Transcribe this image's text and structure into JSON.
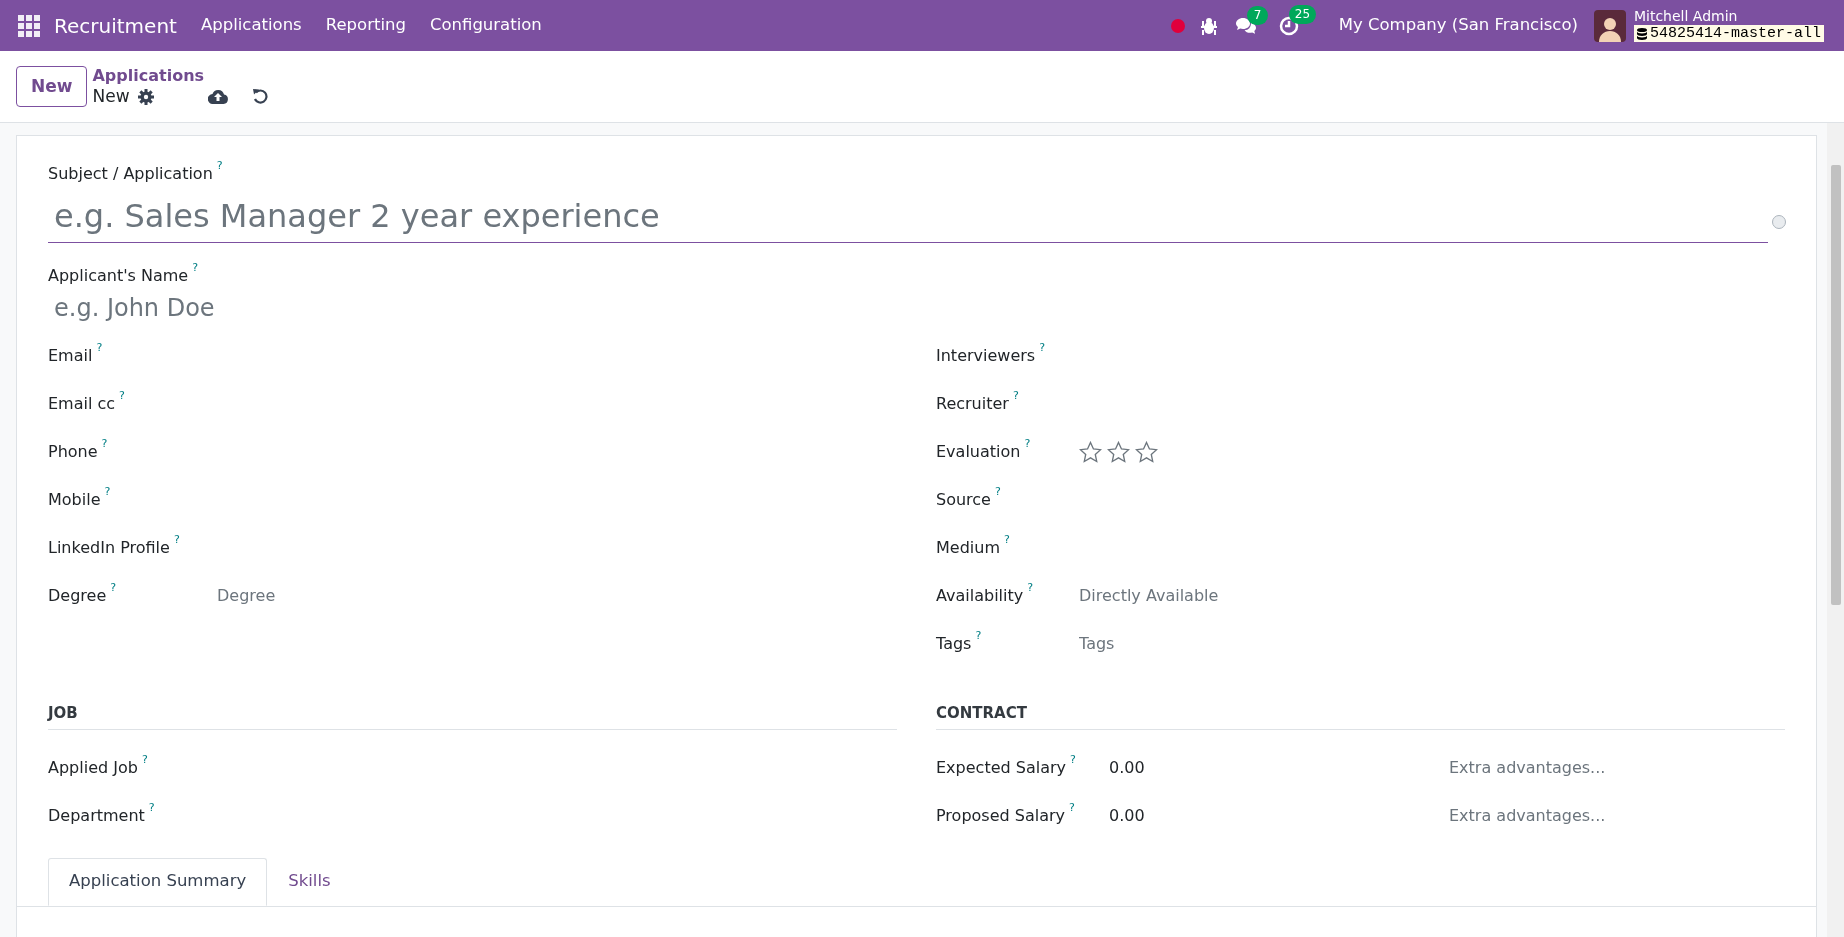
{
  "navbar": {
    "app_name": "Recruitment",
    "menus": [
      "Applications",
      "Reporting",
      "Configuration"
    ],
    "chat_count": "7",
    "activity_count": "25",
    "company": "My Company (San Francisco)",
    "user_name": "Mitchell Admin",
    "database": "54825414-master-all"
  },
  "control_panel": {
    "new_button": "New",
    "breadcrumb": "Applications",
    "record": "New"
  },
  "form": {
    "subject": {
      "label": "Subject / Application",
      "help": "?",
      "placeholder": "e.g. Sales Manager 2 year experience"
    },
    "applicant_name": {
      "label": "Applicant's Name",
      "help": "?",
      "placeholder": "e.g. John Doe"
    },
    "left_fields": [
      {
        "kind": "text",
        "label": "Email",
        "help": "?"
      },
      {
        "kind": "text",
        "label": "Email cc",
        "help": "?"
      },
      {
        "kind": "text",
        "label": "Phone",
        "help": "?"
      },
      {
        "kind": "text",
        "label": "Mobile",
        "help": "?"
      },
      {
        "kind": "text",
        "label": "LinkedIn Profile",
        "help": "?"
      },
      {
        "kind": "text",
        "label": "Degree",
        "help": "?",
        "placeholder": "Degree"
      }
    ],
    "right_fields": [
      {
        "kind": "text",
        "label": "Interviewers",
        "help": "?"
      },
      {
        "kind": "text",
        "label": "Recruiter",
        "help": "?"
      },
      {
        "kind": "stars",
        "label": "Evaluation",
        "help": "?",
        "stars": 0
      },
      {
        "kind": "text",
        "label": "Source",
        "help": "?"
      },
      {
        "kind": "text",
        "label": "Medium",
        "help": "?"
      },
      {
        "kind": "text",
        "label": "Availability",
        "help": "?",
        "placeholder": "Directly Available"
      },
      {
        "kind": "text",
        "label": "Tags",
        "help": "?",
        "placeholder": "Tags"
      }
    ],
    "job": {
      "title": "JOB",
      "fields": [
        {
          "label": "Applied Job",
          "help": "?"
        },
        {
          "label": "Department",
          "help": "?"
        }
      ]
    },
    "contract": {
      "title": "CONTRACT",
      "fields": [
        {
          "label": "Expected Salary",
          "help": "?",
          "value": "0.00",
          "extra_placeholder": "Extra advantages..."
        },
        {
          "label": "Proposed Salary",
          "help": "?",
          "value": "0.00",
          "extra_placeholder": "Extra advantages..."
        }
      ]
    },
    "tabs": [
      {
        "label": "Application Summary",
        "selected": true
      },
      {
        "label": "Skills",
        "selected": false
      }
    ]
  }
}
